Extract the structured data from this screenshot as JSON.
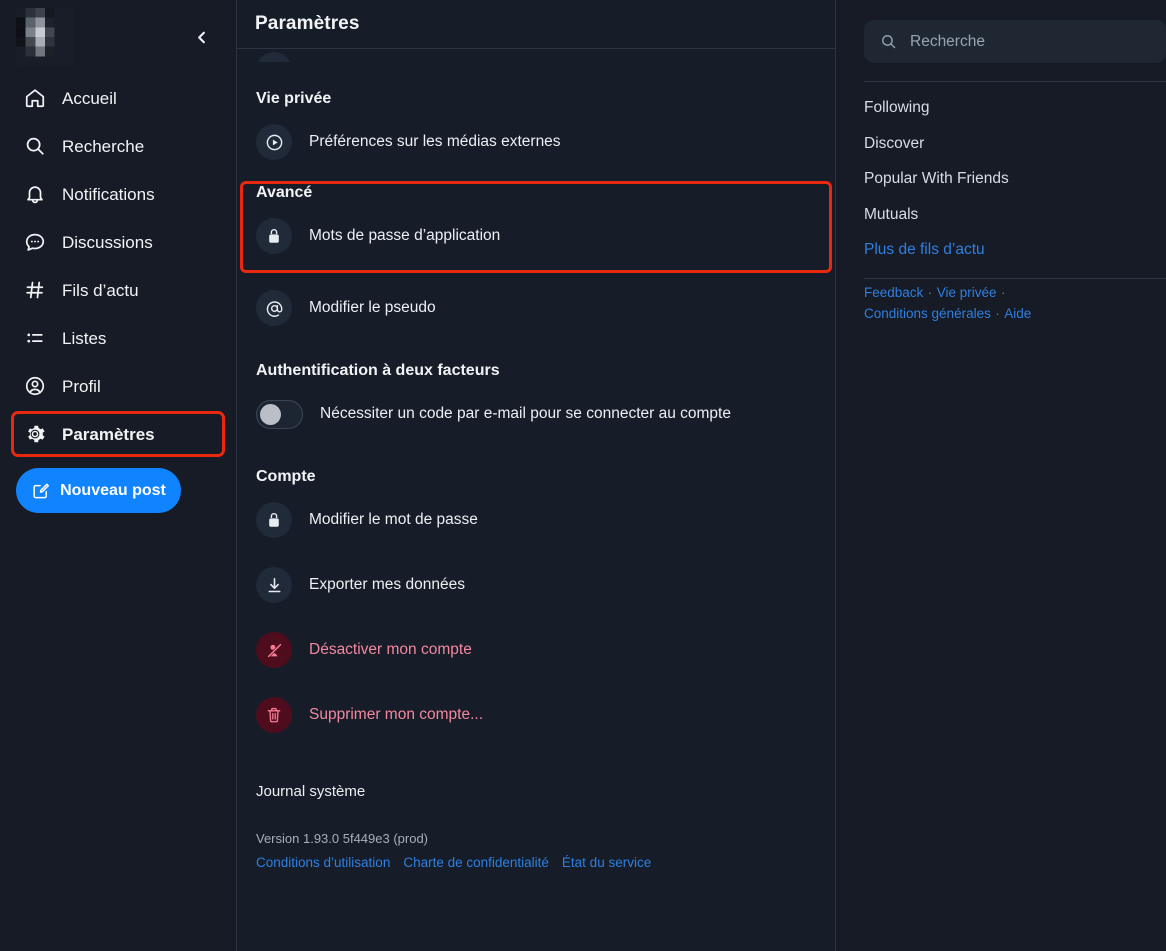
{
  "sidebar": {
    "avatar_alt": "user-avatar",
    "collapse_icon": "chevron-left-icon",
    "items": [
      {
        "label": "Accueil",
        "icon": "home-icon",
        "active": false
      },
      {
        "label": "Recherche",
        "icon": "search-icon",
        "active": false
      },
      {
        "label": "Notifications",
        "icon": "bell-icon",
        "active": false
      },
      {
        "label": "Discussions",
        "icon": "chat-bubble-icon",
        "active": false
      },
      {
        "label": "Fils d’actu",
        "icon": "hash-icon",
        "active": false
      },
      {
        "label": "Listes",
        "icon": "list-icon",
        "active": false
      },
      {
        "label": "Profil",
        "icon": "user-circle-icon",
        "active": false
      },
      {
        "label": "Paramètres",
        "icon": "gear-icon",
        "active": true
      }
    ],
    "compose": {
      "label": "Nouveau post",
      "icon": "compose-icon"
    }
  },
  "main": {
    "header_title": "Paramètres",
    "privacy": {
      "title": "Vie privée",
      "rows": [
        {
          "label": "Préférences sur les médias externes",
          "icon": "play-circle-icon"
        }
      ]
    },
    "advanced": {
      "title": "Avancé",
      "rows": [
        {
          "label": "Mots de passe d’application",
          "icon": "lock-icon"
        }
      ],
      "after_rows": [
        {
          "label": "Modifier le pseudo",
          "icon": "at-sign-icon"
        }
      ]
    },
    "two_factor": {
      "title": "Authentification à deux facteurs",
      "toggle_label": "Nécessiter un code par e-mail pour se connecter au compte",
      "toggle_state": "off"
    },
    "account": {
      "title": "Compte",
      "rows": [
        {
          "label": "Modifier le mot de passe",
          "icon": "lock-icon",
          "danger": false
        },
        {
          "label": "Exporter mes données",
          "icon": "download-icon",
          "danger": false
        },
        {
          "label": "Désactiver mon compte",
          "icon": "user-slash-icon",
          "danger": true
        },
        {
          "label": "Supprimer mon compte...",
          "icon": "trash-icon",
          "danger": true
        }
      ]
    },
    "system_log": {
      "title": "Journal système"
    },
    "version": "Version 1.93.0 5f449e3 (prod)",
    "footer_links": [
      "Conditions d’utilisation",
      "Charte de confidentialité",
      "État du service"
    ]
  },
  "right_rail": {
    "search": {
      "placeholder": "Recherche",
      "icon": "search-icon"
    },
    "feeds": [
      {
        "label": "Following",
        "more": false
      },
      {
        "label": "Discover",
        "more": false
      },
      {
        "label": "Popular With Friends",
        "more": false
      },
      {
        "label": "Mutuals",
        "more": false
      },
      {
        "label": "Plus de fils d’actu",
        "more": true
      }
    ],
    "footer": {
      "line1": [
        "Feedback",
        "Vie privée"
      ],
      "line2": [
        "Conditions générales",
        "Aide"
      ],
      "separator": "·"
    }
  },
  "colors": {
    "accent_blue": "#1083fe",
    "link_blue": "#2f7fe0",
    "danger_red": "#f4879e",
    "danger_bg": "#4f0c1d",
    "highlight_outline": "#e8290f",
    "sidebar_bg": "#161b26",
    "content_bg": "#161d29"
  }
}
